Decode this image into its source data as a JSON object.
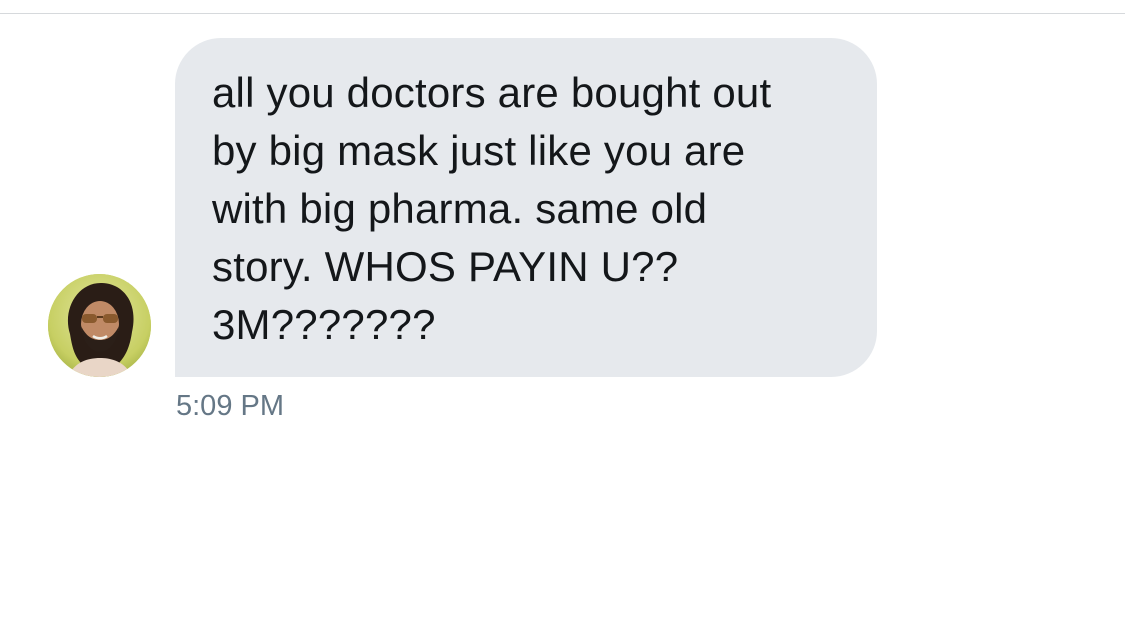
{
  "conversation": {
    "message": {
      "text": "all you doctors are bought out\nby big mask just like you are\nwith big pharma. same old\nstory. WHOS PAYIN U??\n3M???????",
      "timestamp": "5:09 PM"
    },
    "sender": {
      "avatar": "user-avatar-photo"
    }
  },
  "colors": {
    "bubble_background": "#e6e9ed",
    "message_text": "#14171a",
    "timestamp_text": "#657786",
    "divider": "#d6d9dc"
  }
}
